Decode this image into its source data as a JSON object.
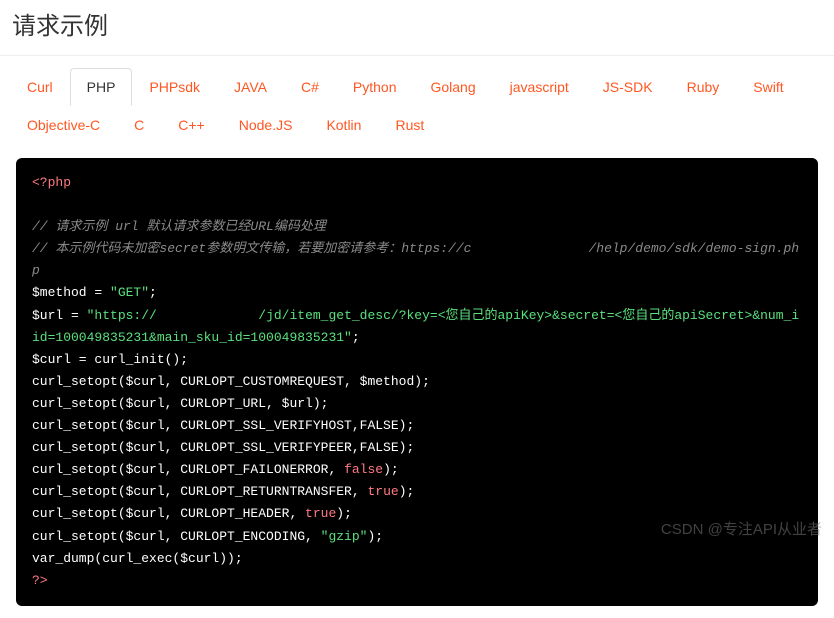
{
  "heading": "请求示例",
  "tabs": [
    {
      "label": "Curl",
      "active": false
    },
    {
      "label": "PHP",
      "active": true
    },
    {
      "label": "PHPsdk",
      "active": false
    },
    {
      "label": "JAVA",
      "active": false
    },
    {
      "label": "C#",
      "active": false
    },
    {
      "label": "Python",
      "active": false
    },
    {
      "label": "Golang",
      "active": false
    },
    {
      "label": "javascript",
      "active": false
    },
    {
      "label": "JS-SDK",
      "active": false
    },
    {
      "label": "Ruby",
      "active": false
    },
    {
      "label": "Swift",
      "active": false
    },
    {
      "label": "Objective-C",
      "active": false
    },
    {
      "label": "C",
      "active": false
    },
    {
      "label": "C++",
      "active": false
    },
    {
      "label": "Node.JS",
      "active": false
    },
    {
      "label": "Kotlin",
      "active": false
    },
    {
      "label": "Rust",
      "active": false
    }
  ],
  "code": {
    "open_tag": "<?php",
    "comment1": "// 请求示例 url 默认请求参数已经URL编码处理",
    "comment2_a": "// 本示例代码未加密secret参数明文传输，若要加密请参考：https://c",
    "comment2_b": "/help/demo/sdk/demo-sign.php",
    "method_var": "$method",
    "method_val": "\"GET\"",
    "url_var": "$url",
    "url_val_a": "\"https://",
    "url_val_b": "/jd/item_get_desc/?key=<您自己的apiKey>&secret=<您自己的apiSecret>&num_iid=100049835231&main_sku_id=100049835231\"",
    "curl_init": "$curl = curl_init();",
    "line_customrequest_a": "curl_setopt($curl, CURLOPT_CUSTOMREQUEST, ",
    "line_customrequest_b": "$method",
    "line_customrequest_c": ");",
    "line_url_a": "curl_setopt($curl, CURLOPT_URL, ",
    "line_url_b": "$url",
    "line_url_c": ");",
    "line_verifyhost": "curl_setopt($curl, CURLOPT_SSL_VERIFYHOST,FALSE);",
    "line_verifypeer": "curl_setopt($curl, CURLOPT_SSL_VERIFYPEER,FALSE);",
    "line_failonerror_a": "curl_setopt($curl, CURLOPT_FAILONERROR, ",
    "false_val": "false",
    "line_failonerror_c": ");",
    "line_returntransfer_a": "curl_setopt($curl, CURLOPT_RETURNTRANSFER, ",
    "true_val": "true",
    "line_returntransfer_c": ");",
    "line_header_a": "curl_setopt($curl, CURLOPT_HEADER, ",
    "line_header_c": ");",
    "line_encoding_a": "curl_setopt($curl, CURLOPT_ENCODING, ",
    "gzip_val": "\"gzip\"",
    "line_encoding_c": ");",
    "line_vardump": "var_dump(curl_exec($curl));",
    "close_tag": "?>"
  },
  "watermark": "CSDN @专注API从业者"
}
